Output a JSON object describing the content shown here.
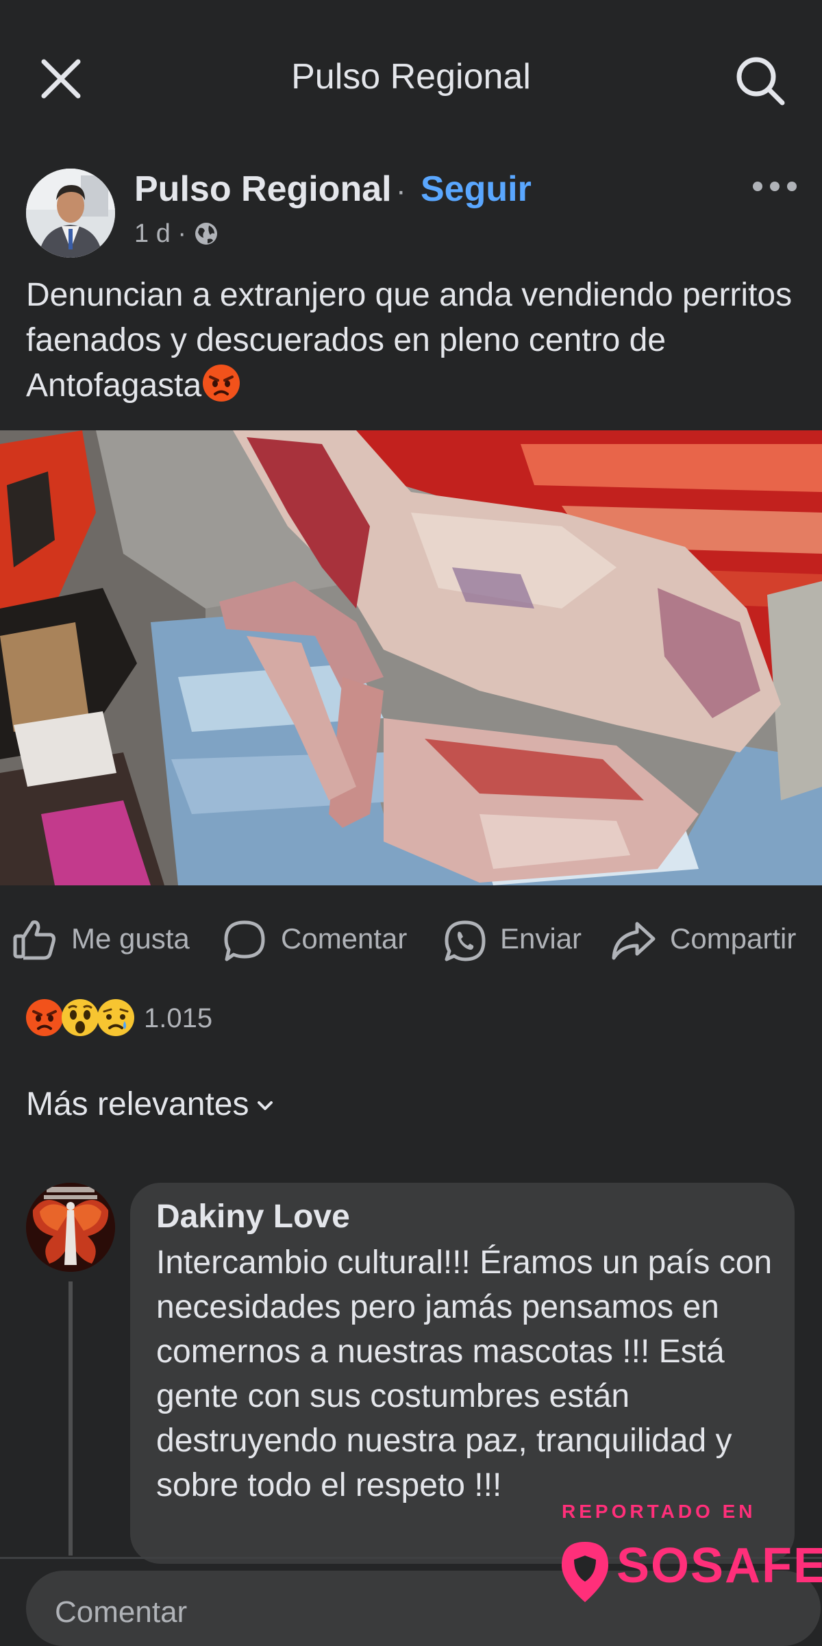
{
  "topbar": {
    "title": "Pulso Regional",
    "close_icon": "close-icon",
    "search_icon": "search-icon"
  },
  "post": {
    "author": "Pulso Regional",
    "follow_label": "Seguir",
    "time": "1 d",
    "audience_icon": "globe-icon",
    "text": "Denuncian a extranjero que anda vendiendo perritos faenados y descuerados en pleno centro de Antofagasta",
    "text_emoji": "angry-face-emoji"
  },
  "actions": {
    "like": "Me gusta",
    "comment": "Comentar",
    "send": "Enviar",
    "share": "Compartir"
  },
  "reactions": {
    "emojis": [
      "angry",
      "wow",
      "sad"
    ],
    "count": "1.015"
  },
  "comments": {
    "sort_label": "Más relevantes",
    "items": [
      {
        "author": "Dakiny Love",
        "text": "Intercambio cultural!!! Éramos un país con necesidades pero jamás pensamos en comernos a nuestras mascotas !!! Está gente con sus costumbres están destruyendo nuestra paz, tranquilidad y sobre todo el respeto !!!"
      }
    ],
    "compose_placeholder": "Comentar"
  },
  "watermark": {
    "top": "REPORTADO EN",
    "brand": "SOSAFE",
    "color": "#ff2f7a"
  },
  "colors": {
    "background": "#242526",
    "link": "#5aa7ff",
    "bubble": "#3a3b3c"
  }
}
